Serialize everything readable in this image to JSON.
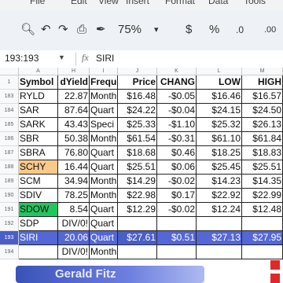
{
  "menu": [
    "File",
    "Edit",
    "View",
    "Insert",
    "Format",
    "Data",
    "Tools"
  ],
  "toolbar": {
    "zoom": "75%",
    "currency": "$",
    "percent": "%",
    "dec_decrease": ".0",
    "dec_increase": ".00"
  },
  "formula_bar": {
    "cell_ref": "193:193",
    "fx": "fx",
    "value": "SIRI"
  },
  "columns": [
    "A",
    "H",
    "I",
    "J",
    "K",
    "L",
    "M"
  ],
  "headers": [
    "Symbol",
    "dYield",
    "Frequency",
    "Price",
    "CHANG",
    "LOW",
    "HIGH",
    "Rise"
  ],
  "rows": [
    {
      "num": "1",
      "cells": [
        "Symbol",
        "dYield",
        "Freque",
        "Price",
        "CHANG",
        "LOW",
        "HIGH",
        "Ris"
      ]
    },
    {
      "num": "183",
      "cells": [
        "RYLD",
        "22.87",
        "Month",
        "$16.48",
        "-$0.05",
        "$16.46",
        "$16.57",
        ""
      ]
    },
    {
      "num": "184",
      "cells": [
        "SAR",
        "87.64",
        "Quart",
        "$24.22",
        "-$0.04",
        "$24.15",
        "$24.50",
        "$"
      ]
    },
    {
      "num": "185",
      "cells": [
        "SARK",
        "43.43",
        "Speci",
        "$25.33",
        "-$1.10",
        "$25.32",
        "$26.13",
        ""
      ]
    },
    {
      "num": "186",
      "cells": [
        "SBR",
        "50.38",
        "Month",
        "$61.54",
        "-$0.31",
        "$61.10",
        "$61.84",
        "$"
      ]
    },
    {
      "num": "187",
      "cells": [
        "SBRA",
        "76.80",
        "Quart",
        "$18.68",
        "$0.46",
        "$18.25",
        "$18.83",
        "$"
      ]
    },
    {
      "num": "188",
      "cells": [
        "SCHY",
        "16.44",
        "Quart",
        "$25.51",
        "$0.06",
        "$25.45",
        "$25.51",
        ""
      ]
    },
    {
      "num": "189",
      "cells": [
        "SCM",
        "34.94",
        "Month",
        "$14.29",
        "-$0.02",
        "$14.23",
        "$14.35",
        ""
      ]
    },
    {
      "num": "190",
      "cells": [
        "SDIV",
        "78.25",
        "Month",
        "$22.98",
        "$0.17",
        "$22.92",
        "$22.99",
        "$"
      ]
    },
    {
      "num": "191",
      "cells": [
        "SDOW",
        "8.54",
        "Quart",
        "$12.29",
        "-$0.02",
        "$12.24",
        "$12.48",
        ""
      ]
    },
    {
      "num": "192",
      "cells": [
        "SDP",
        "DIV/0!",
        "Quart",
        "",
        "",
        "",
        "",
        ""
      ]
    },
    {
      "num": "193",
      "cells": [
        "SIRI",
        "20.06",
        "Quart",
        "$27.61",
        "$0.51",
        "$27.13",
        "$27.95",
        ""
      ]
    },
    {
      "num": "194",
      "cells": [
        "",
        "DIV/0!",
        "Month",
        "",
        "",
        "",
        "",
        ""
      ]
    }
  ],
  "toast_text": "Gerald Fitz",
  "colors": {
    "accent": "#4b5dc7",
    "highlight_orange": "#f9c98a",
    "highlight_green": "#22c55e"
  }
}
